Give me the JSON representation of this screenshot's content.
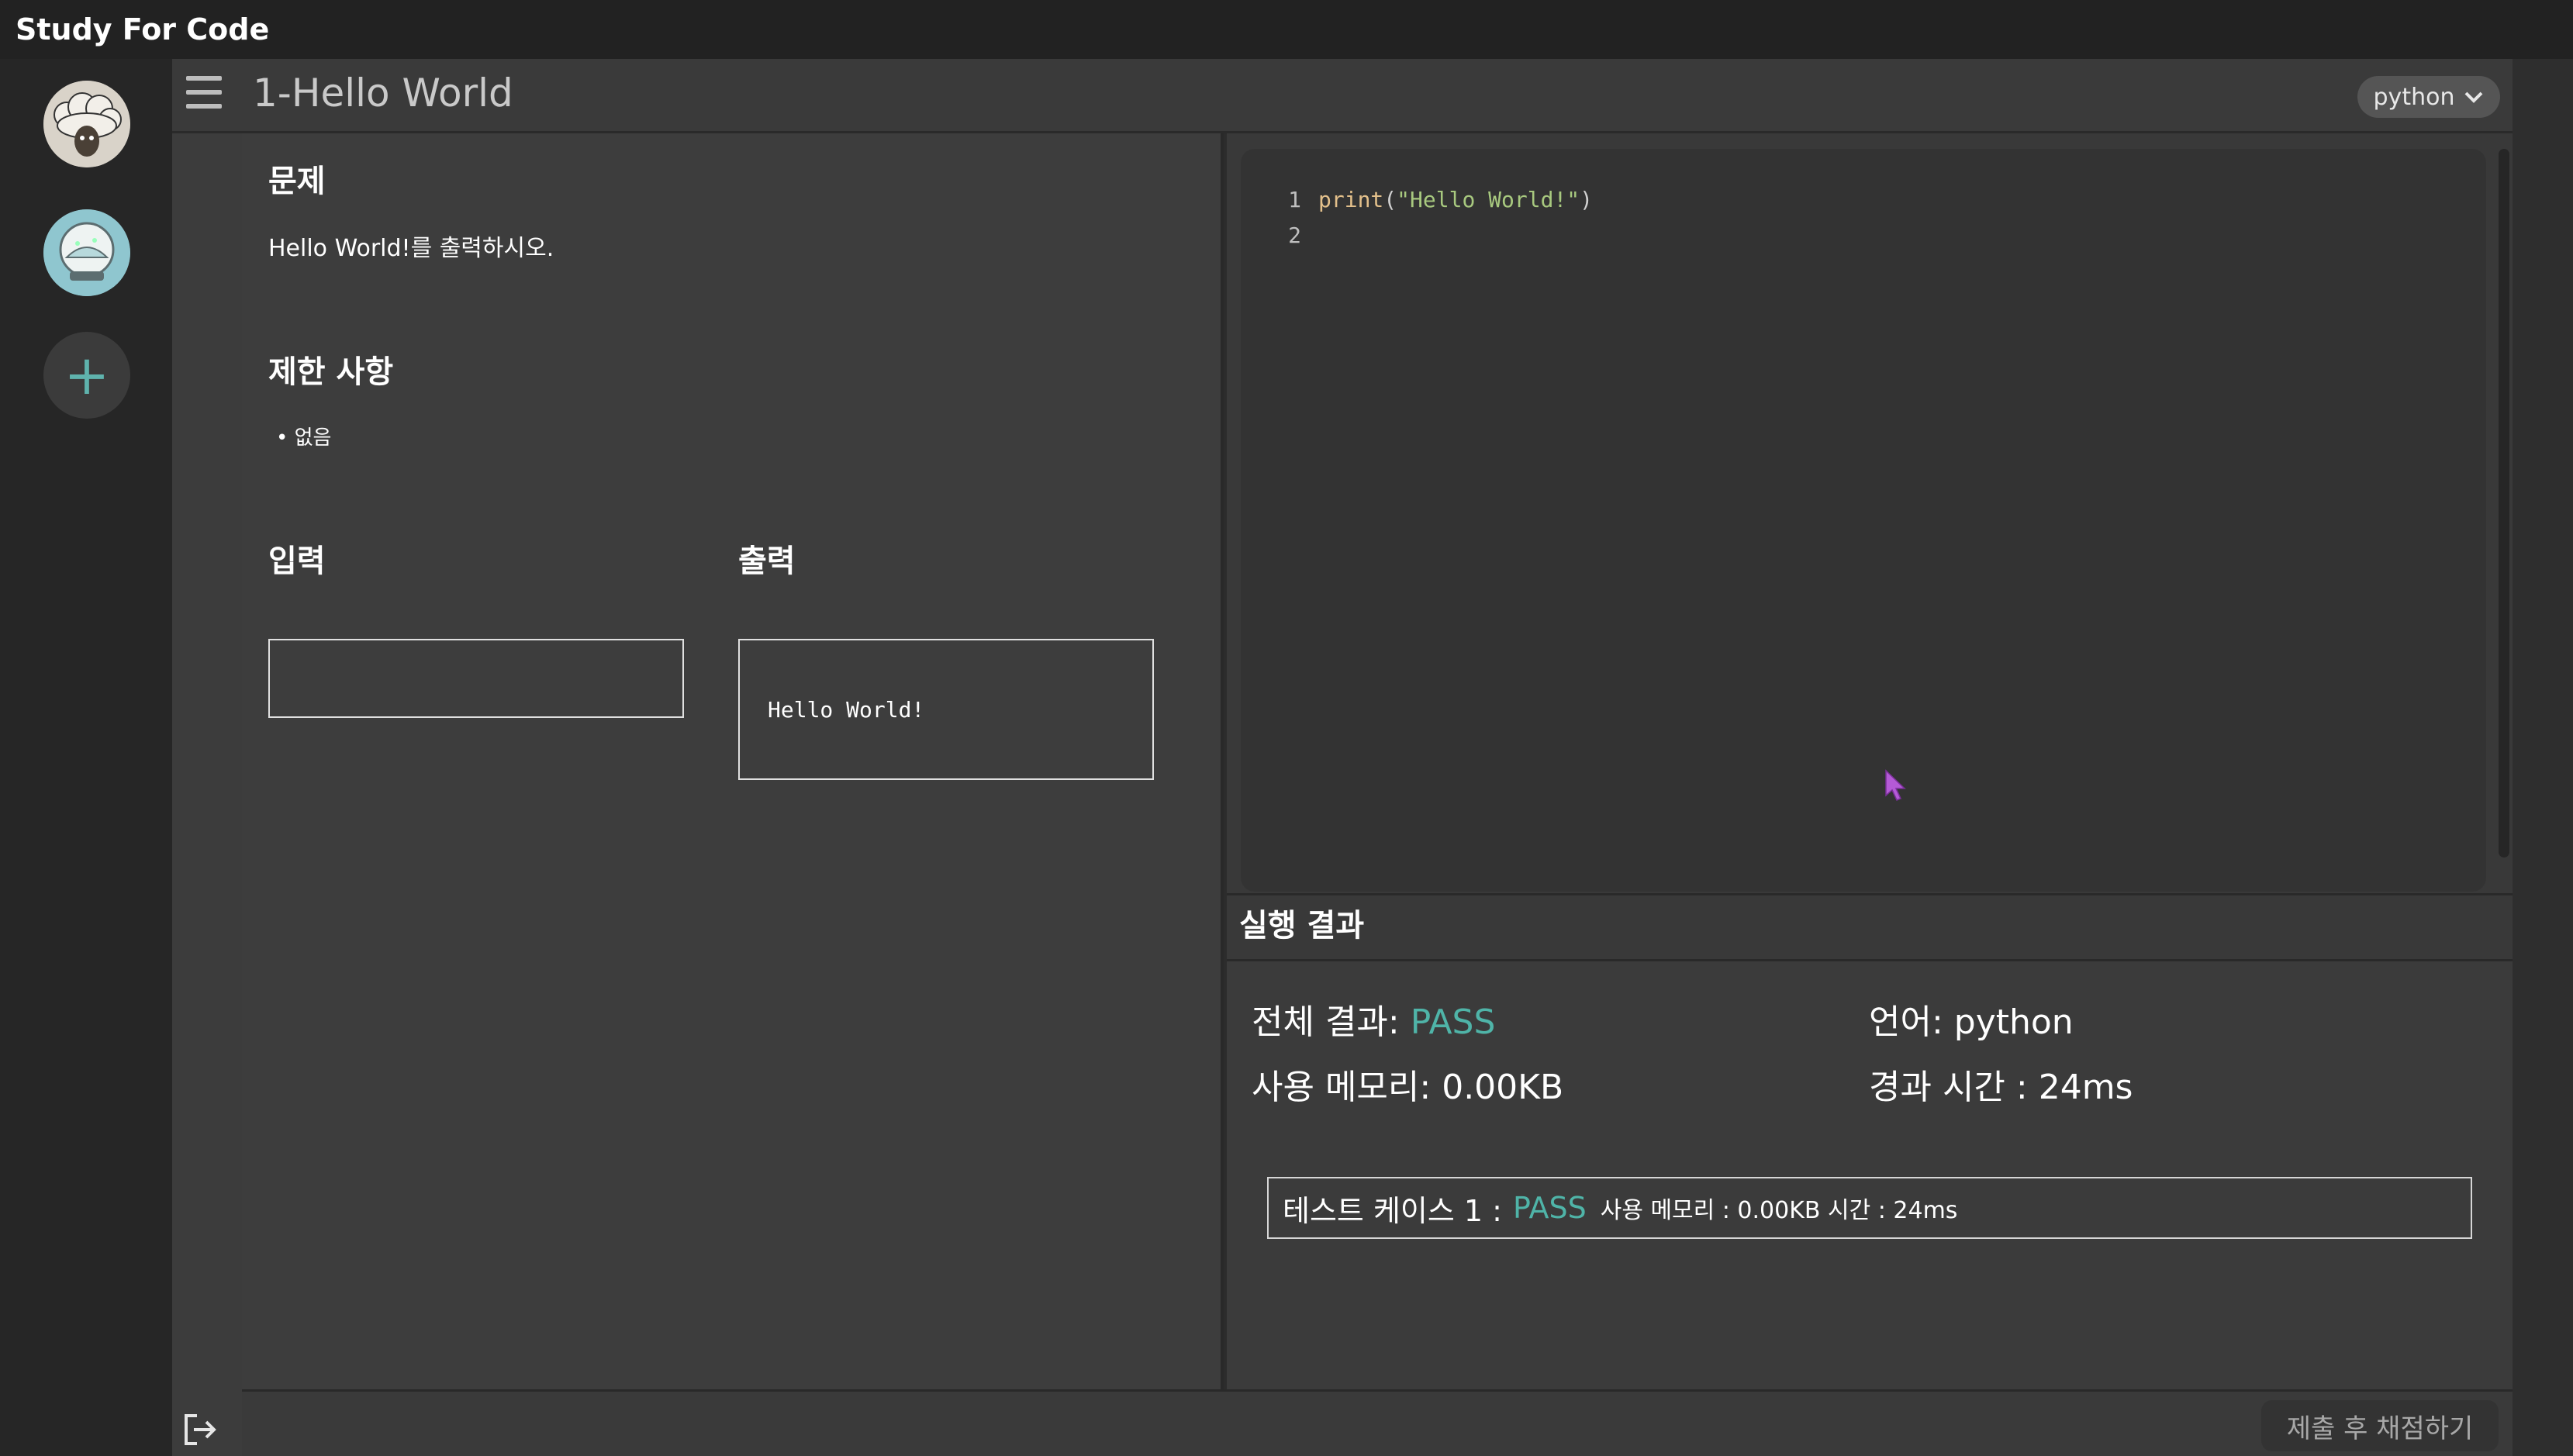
{
  "app": {
    "title": "Study For Code"
  },
  "header": {
    "title": "1-Hello World",
    "language": "python"
  },
  "problem": {
    "title": "문제",
    "text": "Hello World!를 출력하시오.",
    "limits_title": "제한 사항",
    "limits": [
      "없음"
    ],
    "input_title": "입력",
    "input_value": "",
    "output_title": "출력",
    "output_value": "Hello World!"
  },
  "editor": {
    "lines": [
      {
        "number": "1",
        "tokens": [
          "print",
          "(",
          "\"Hello World!\"",
          ")"
        ]
      },
      {
        "number": "2",
        "tokens": []
      }
    ]
  },
  "result": {
    "title": "실행 결과",
    "overall_label": "전체 결과: ",
    "overall_status": "PASS",
    "language_label": "언어: ",
    "language_value": "python",
    "memory_label": "사용 메모리: ",
    "memory_value": "0.00KB",
    "time_label": "경과 시간 : ",
    "time_value": "24ms",
    "testcases": [
      {
        "label": "테스트 케이스 1 :",
        "status": "PASS",
        "details": "사용 메모리 : 0.00KB  시간 : 24ms"
      }
    ]
  },
  "footer": {
    "submit_label": "제출 후 채점하기"
  },
  "colors": {
    "pass": "#4fb4a8",
    "background": "#2c2c2c",
    "panel": "#3d3d3d"
  },
  "icons": [
    "menu-icon",
    "chevron-down-icon",
    "collapse-left-icon",
    "add-icon",
    "logout-icon",
    "pointer-cursor-icon"
  ]
}
